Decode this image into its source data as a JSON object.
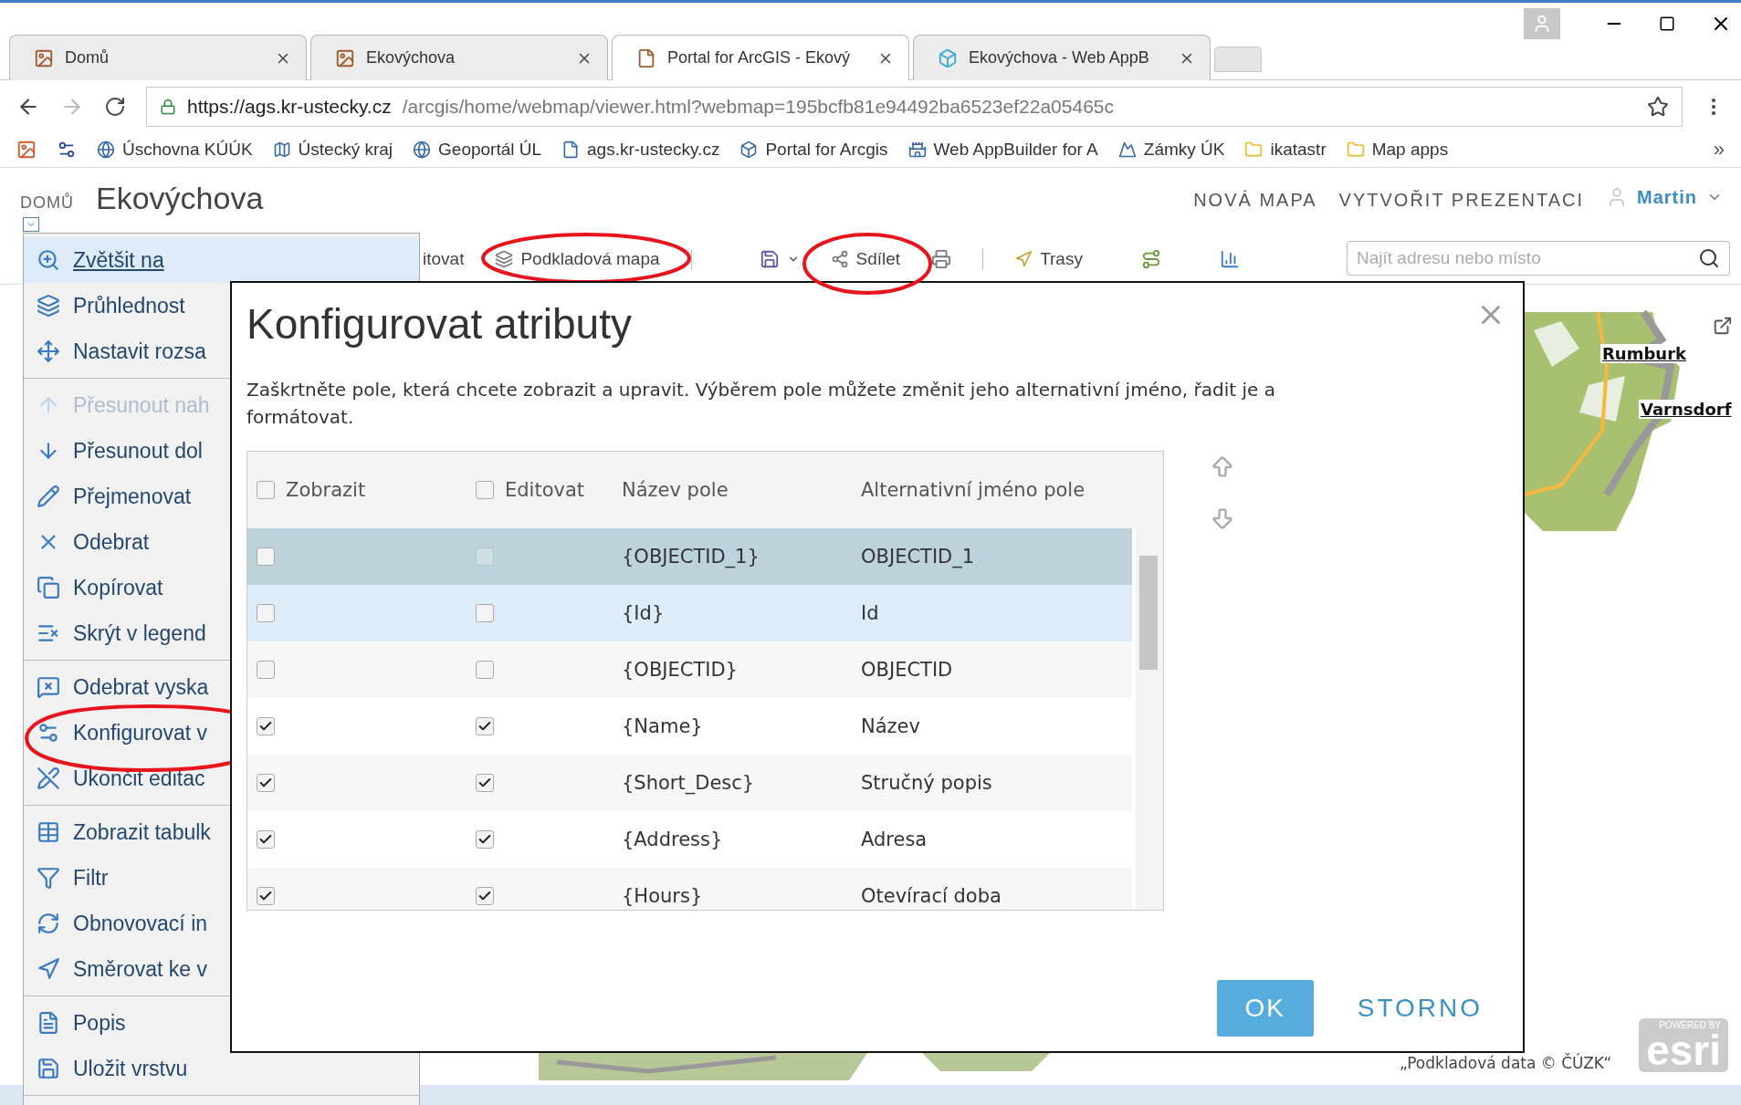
{
  "browser": {
    "tabs": [
      {
        "label": "Domů",
        "selected": false
      },
      {
        "label": "Ekovýchova",
        "selected": false
      },
      {
        "label": "Portal for ArcGIS - Ekový",
        "selected": true
      },
      {
        "label": "Ekovýchova - Web AppB",
        "selected": false
      }
    ],
    "url_host": "https://ags.kr-ustecky.cz",
    "url_path": "/arcgis/home/webmap/viewer.html?webmap=195bcfb81e94492ba6523ef22a05465c",
    "bookmarks": [
      "Úschovna KÚÚK",
      "Ústecký kraj",
      "Geoportál ÚL",
      "ags.kr-ustecky.cz",
      "Portal for Arcgis",
      "Web AppBuilder for A",
      "Zámky ÚK",
      "ikatastr",
      "Map apps"
    ],
    "bookmarks_more": "»"
  },
  "header": {
    "home": "DOMŮ",
    "title": "Ekovýchova",
    "nav": [
      "NOVÁ MAPA",
      "VYTVOŘIT PREZENTACI"
    ],
    "user": "Martin"
  },
  "toolbar": {
    "edit_label": "itovat",
    "basemap_label": "Podkladová mapa",
    "share_label": "Sdílet",
    "directions_label": "Trasy",
    "search_placeholder": "Najít adresu nebo místo"
  },
  "layer_menu": {
    "groups": [
      [
        {
          "label": "Zvětšit na",
          "selected": true,
          "disabled": false
        },
        {
          "label": "Průhlednost",
          "selected": false,
          "disabled": false
        },
        {
          "label": "Nastavit rozsa",
          "selected": false,
          "disabled": false
        }
      ],
      [
        {
          "label": "Přesunout nah",
          "selected": false,
          "disabled": true
        },
        {
          "label": "Přesunout dol",
          "selected": false,
          "disabled": false
        },
        {
          "label": "Přejmenovat",
          "selected": false,
          "disabled": false
        },
        {
          "label": "Odebrat",
          "selected": false,
          "disabled": false
        },
        {
          "label": "Kopírovat",
          "selected": false,
          "disabled": false
        },
        {
          "label": "Skrýt v legend",
          "selected": false,
          "disabled": false
        }
      ],
      [
        {
          "label": "Odebrat vyska",
          "selected": false,
          "disabled": false
        },
        {
          "label": "Konfigurovat v",
          "selected": false,
          "disabled": false
        },
        {
          "label": "Ukončit editac",
          "selected": false,
          "disabled": false
        }
      ],
      [
        {
          "label": "Zobrazit tabulk",
          "selected": false,
          "disabled": false
        },
        {
          "label": "Filtr",
          "selected": false,
          "disabled": false
        },
        {
          "label": "Obnovovací in",
          "selected": false,
          "disabled": false
        },
        {
          "label": "Směrovat ke v",
          "selected": false,
          "disabled": false
        }
      ],
      [
        {
          "label": "Popis",
          "selected": false,
          "disabled": false
        },
        {
          "label": "Uložit vrstvu",
          "selected": false,
          "disabled": false
        }
      ]
    ]
  },
  "dialog": {
    "title": "Konfigurovat atributy",
    "description": "Zaškrtněte pole, která chcete zobrazit a upravit. Výběrem pole můžete změnit jeho alternativní jméno, řadit je a formátovat.",
    "columns": [
      "Zobrazit",
      "Editovat",
      "Název pole",
      "Alternativní jméno pole"
    ],
    "all_show": false,
    "all_edit": false,
    "rows": [
      {
        "field": "{OBJECTID_1}",
        "alias": "OBJECTID_1",
        "show": false,
        "edit": false,
        "edit_disabled": true,
        "selected": true,
        "hovered": false
      },
      {
        "field": "{Id}",
        "alias": "Id",
        "show": false,
        "edit": false,
        "edit_disabled": false,
        "selected": false,
        "hovered": true
      },
      {
        "field": "{OBJECTID}",
        "alias": "OBJECTID",
        "show": false,
        "edit": false,
        "edit_disabled": false,
        "selected": false,
        "hovered": false
      },
      {
        "field": "{Name}",
        "alias": "Název",
        "show": true,
        "edit": true,
        "edit_disabled": false,
        "selected": false,
        "hovered": false
      },
      {
        "field": "{Short_Desc}",
        "alias": "Stručný popis",
        "show": true,
        "edit": true,
        "edit_disabled": false,
        "selected": false,
        "hovered": false
      },
      {
        "field": "{Address}",
        "alias": "Adresa",
        "show": true,
        "edit": true,
        "edit_disabled": false,
        "selected": false,
        "hovered": false
      },
      {
        "field": "{Hours}",
        "alias": "Otevírací doba",
        "show": true,
        "edit": true,
        "edit_disabled": false,
        "selected": false,
        "hovered": false
      }
    ],
    "ok": "OK",
    "cancel": "STORNO"
  },
  "map": {
    "places": [
      "Rumburk",
      "Varnsdorf"
    ],
    "attribution": "„Podkladová data © ČÚZK“",
    "logo_top": "POWERED BY",
    "logo_word": "esri"
  }
}
